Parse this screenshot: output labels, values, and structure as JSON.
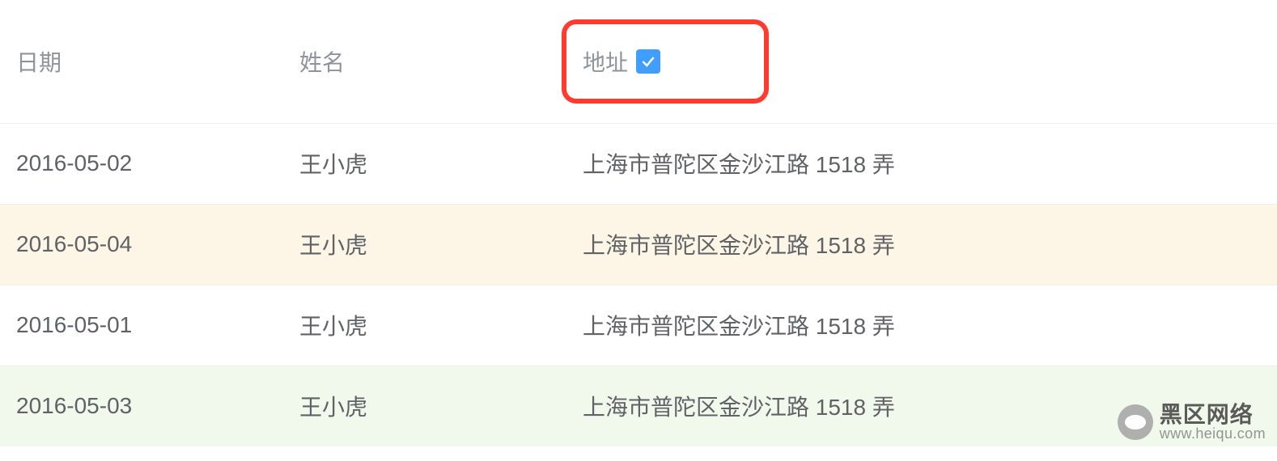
{
  "table": {
    "headers": {
      "date": "日期",
      "name": "姓名",
      "addr": "地址"
    },
    "addr_checkbox_checked": true,
    "rows": [
      {
        "date": "2016-05-02",
        "name": "王小虎",
        "addr": "上海市普陀区金沙江路 1518 弄",
        "status": ""
      },
      {
        "date": "2016-05-04",
        "name": "王小虎",
        "addr": "上海市普陀区金沙江路 1518 弄",
        "status": "warning"
      },
      {
        "date": "2016-05-01",
        "name": "王小虎",
        "addr": "上海市普陀区金沙江路 1518 弄",
        "status": ""
      },
      {
        "date": "2016-05-03",
        "name": "王小虎",
        "addr": "上海市普陀区金沙江路 1518 弄",
        "status": "success"
      }
    ]
  },
  "watermark": {
    "title": "黑区网络",
    "url": "www.heiqu.com"
  },
  "colors": {
    "primary": "#409eff",
    "warning_bg": "#fdf5e6",
    "success_bg": "#f0f9eb",
    "highlight": "#ff3b30"
  }
}
